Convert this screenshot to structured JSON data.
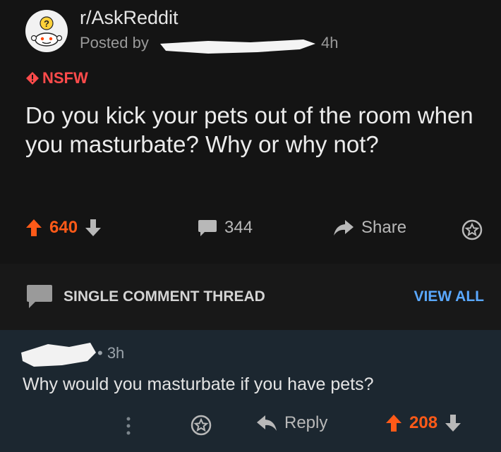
{
  "post": {
    "subreddit": "r/AskReddit",
    "posted_by_prefix": "Posted by",
    "age": "4h",
    "nsfw_label": "NSFW",
    "title": "Do you kick your pets out of the room when you masturbate? Why or why not?",
    "upvotes": "640",
    "comments": "344",
    "share_label": "Share"
  },
  "thread": {
    "label": "SINGLE COMMENT THREAD",
    "view_all": "VIEW ALL"
  },
  "comment": {
    "age": "• 3h",
    "text": "Why would you masturbate if you have pets?",
    "reply_label": "Reply",
    "score": "208"
  },
  "colors": {
    "upvote": "#ff5a18",
    "nsfw": "#ff4b4b",
    "link": "#5aa8ff",
    "comment_bg": "#1c2730"
  },
  "icons": [
    "reddit-snoo-question-avatar-icon",
    "nsfw-diamond-icon",
    "upvote-arrow-icon",
    "downvote-arrow-icon",
    "comment-bubble-icon",
    "share-arrow-icon",
    "award-icon",
    "more-options-icon",
    "reply-arrow-icon"
  ]
}
